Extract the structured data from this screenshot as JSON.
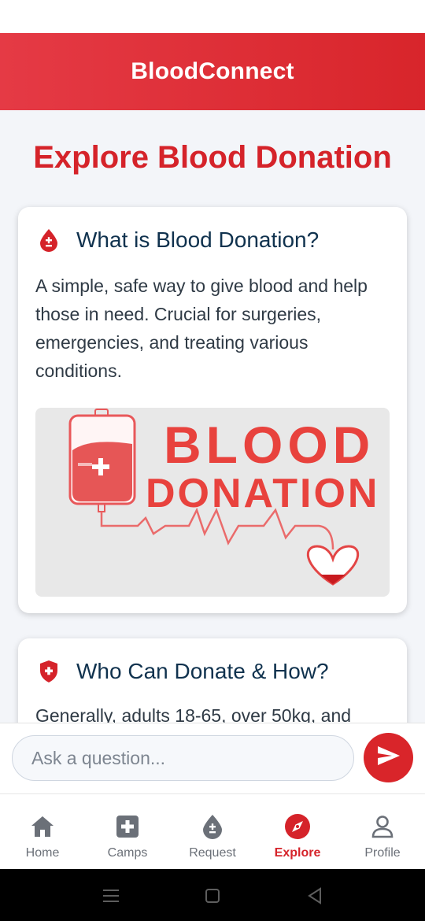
{
  "header": {
    "title": "BloodConnect"
  },
  "page": {
    "title": "Explore Blood Donation"
  },
  "cards": [
    {
      "icon": "blood-drop-icon",
      "title": "What is Blood Donation?",
      "text": "A simple, safe way to give blood and help those in need. Crucial for surgeries, emergencies, and treating various conditions.",
      "image_text_1": "BLOOD",
      "image_text_2": "DONATION"
    },
    {
      "icon": "shield-cross-icon",
      "title": "Who Can Donate & How?",
      "text": "Generally, adults 18-65, over 50kg, and"
    }
  ],
  "chat": {
    "placeholder": "Ask a question..."
  },
  "nav": {
    "items": [
      {
        "label": "Home",
        "icon": "home-icon"
      },
      {
        "label": "Camps",
        "icon": "plus-square-icon"
      },
      {
        "label": "Request",
        "icon": "blood-drop-icon"
      },
      {
        "label": "Explore",
        "icon": "compass-icon",
        "active": true
      },
      {
        "label": "Profile",
        "icon": "user-icon"
      }
    ]
  },
  "colors": {
    "brand": "#d5232a",
    "header_gradient_start": "#e53a45",
    "text_dark": "#10324e"
  }
}
